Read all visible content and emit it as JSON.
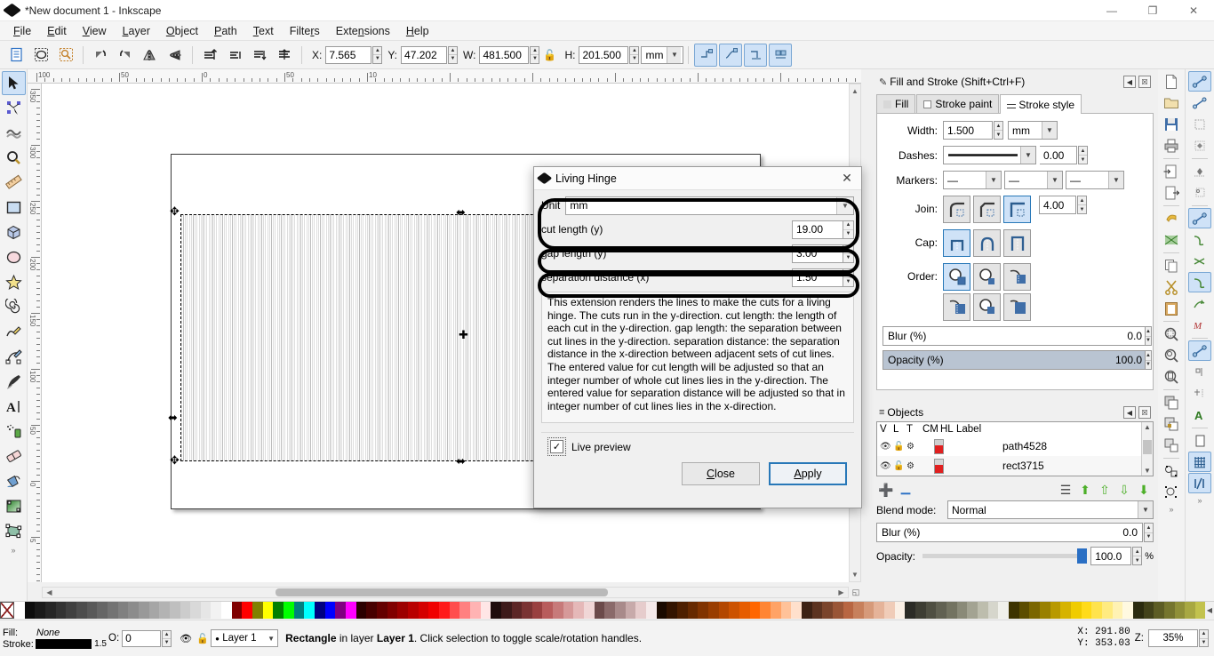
{
  "window": {
    "title": "*New document 1 - Inkscape",
    "app_icon": "inkscape-logo-icon",
    "controls": {
      "minimize": "—",
      "maximize": "❐",
      "close": "✕"
    }
  },
  "menubar": {
    "items": [
      {
        "label": "File",
        "accel": "F"
      },
      {
        "label": "Edit",
        "accel": "E"
      },
      {
        "label": "View",
        "accel": "V"
      },
      {
        "label": "Layer",
        "accel": "L"
      },
      {
        "label": "Object",
        "accel": "O"
      },
      {
        "label": "Path",
        "accel": "P"
      },
      {
        "label": "Text",
        "accel": "T"
      },
      {
        "label": "Filters",
        "accel": "F"
      },
      {
        "label": "Extensions",
        "accel": "n"
      },
      {
        "label": "Help",
        "accel": "H"
      }
    ]
  },
  "commandbar": {
    "buttons": [
      {
        "name": "select-all-icon",
        "glyph": "☰"
      },
      {
        "name": "select-all-in-all-layers-icon",
        "glyph": "⬚"
      },
      {
        "name": "deselect-icon",
        "glyph": "▢"
      },
      {
        "name": "rotate-90-ccw-icon",
        "glyph": "↺"
      },
      {
        "name": "rotate-90-cw-icon",
        "glyph": "↻"
      },
      {
        "name": "flip-horizontal-icon",
        "glyph": "◀▶"
      },
      {
        "name": "flip-vertical-icon",
        "glyph": "◁"
      },
      {
        "name": "raise-to-top-icon",
        "glyph": "⤒"
      },
      {
        "name": "raise-icon",
        "glyph": "↑"
      },
      {
        "name": "lower-icon",
        "glyph": "↓"
      },
      {
        "name": "lower-to-bottom-icon",
        "glyph": "⤓"
      }
    ],
    "snap_buttons": [
      {
        "name": "snap-nodes-icon",
        "glyph": "↱"
      },
      {
        "name": "snap-paths-icon",
        "glyph": "↰"
      },
      {
        "name": "snap-bbox-icon",
        "glyph": "↳"
      },
      {
        "name": "snap-page-icon",
        "glyph": "⇉"
      }
    ]
  },
  "transform": {
    "x": {
      "label": "X:",
      "value": "7.565"
    },
    "y": {
      "label": "Y:",
      "value": "47.202"
    },
    "w": {
      "label": "W:",
      "value": "481.500"
    },
    "lock_icon": "lock-ratio-icon",
    "h": {
      "label": "H:",
      "value": "201.500"
    },
    "unit": "mm"
  },
  "toolbox": {
    "tools": [
      {
        "name": "selector-tool",
        "glyph": "➤",
        "selected": true
      },
      {
        "name": "node-tool",
        "glyph": "✶",
        "selected": false
      },
      {
        "name": "tweak-tool",
        "glyph": "≋",
        "selected": false
      },
      {
        "name": "zoom-tool",
        "glyph": "⌕",
        "selected": false
      },
      {
        "name": "measure-tool",
        "glyph": "⌗",
        "selected": false
      },
      {
        "name": "rectangle-tool",
        "glyph": "▭",
        "selected": false
      },
      {
        "name": "3dbox-tool",
        "glyph": "⬡",
        "selected": false
      },
      {
        "name": "ellipse-tool",
        "glyph": "◯",
        "selected": false
      },
      {
        "name": "star-tool",
        "glyph": "★",
        "selected": false
      },
      {
        "name": "spiral-tool",
        "glyph": "◎",
        "selected": false
      },
      {
        "name": "pencil-tool",
        "glyph": "✎",
        "selected": false
      },
      {
        "name": "bezier-tool",
        "glyph": "✐",
        "selected": false
      },
      {
        "name": "calligraphy-tool",
        "glyph": "✒",
        "selected": false
      },
      {
        "name": "text-tool",
        "glyph": "A",
        "selected": false
      },
      {
        "name": "spray-tool",
        "glyph": "⁂",
        "selected": false
      },
      {
        "name": "eraser-tool",
        "glyph": "▱",
        "selected": false
      },
      {
        "name": "paint-bucket-tool",
        "glyph": "◢",
        "selected": false
      },
      {
        "name": "gradient-tool",
        "glyph": "▨",
        "selected": false
      },
      {
        "name": "connector-tool",
        "glyph": "⬚",
        "selected": false
      }
    ],
    "overflow": "»"
  },
  "rulers": {
    "horizontal_labels": [
      "100",
      "50",
      "0",
      "50",
      "10"
    ],
    "vertical_labels": [
      "350",
      "300",
      "250",
      "200",
      "150",
      "100",
      "50",
      "0",
      "5"
    ],
    "lock_icon": "ruler-lock-icon"
  },
  "canvas": {
    "selection_handles": "scale-arrows",
    "cursor": "crosshair-cursor",
    "object": "living-hinge-rect"
  },
  "dialog": {
    "title": "Living Hinge",
    "icon": "inkscape-logo-icon",
    "close_icon": "close-icon",
    "fields": [
      {
        "label": "Unit",
        "type": "select",
        "value": "mm",
        "name": "unit-select"
      },
      {
        "label": "cut length (y)",
        "type": "number",
        "value": "19.00",
        "name": "cut-length-input"
      },
      {
        "label": "gap length (y)",
        "type": "number",
        "value": "3.00",
        "name": "gap-length-input"
      },
      {
        "label": "separation distance (x)",
        "type": "number",
        "value": "1.50",
        "name": "separation-distance-input"
      }
    ],
    "description": "This extension renders the lines to make the cuts for a living hinge. The cuts run in the y-direction. cut length: the length of each cut in the y-direction. gap length: the separation between cut lines in the y-direction. separation distance: the separation distance in the x-direction between adjacent sets of cut lines. The entered value for cut length will be adjusted so that an integer number of whole cut lines lies in the y-direction. The entered value for separation distance will be adjusted so that in integer number of cut lines lies in the x-direction.",
    "live_preview": {
      "label": "Live preview",
      "checked": true,
      "check_glyph": "✓"
    },
    "buttons": {
      "close": "Close",
      "apply": "Apply"
    }
  },
  "fill_stroke": {
    "panel_title": "Fill and Stroke (Shift+Ctrl+F)",
    "panel_icon": "fill-stroke-icon",
    "dock_buttons": {
      "collapse": "◀",
      "close": "☒"
    },
    "tabs": [
      {
        "label": "Fill",
        "name": "tab-fill",
        "active": false
      },
      {
        "label": "Stroke paint",
        "name": "tab-stroke-paint",
        "active": false
      },
      {
        "label": "Stroke style",
        "name": "tab-stroke-style",
        "active": true
      }
    ],
    "width": {
      "label": "Width:",
      "value": "1.500",
      "unit": "mm"
    },
    "dashes": {
      "label": "Dashes:",
      "pattern": "solid-line",
      "offset": "0.00"
    },
    "markers": {
      "label": "Markers:",
      "start": "—",
      "mid": "—",
      "end": "—"
    },
    "join": {
      "label": "Join:",
      "options": [
        "round-join",
        "bevel-join",
        "miter-join"
      ],
      "selected": 2,
      "miter_limit": "4.00"
    },
    "cap": {
      "label": "Cap:",
      "options": [
        "butt-cap",
        "round-cap",
        "square-cap"
      ],
      "selected": 0
    },
    "order": {
      "label": "Order:",
      "options": [
        "fill-stroke-markers",
        "fill-markers-stroke",
        "stroke-fill-markers",
        "stroke-markers-fill",
        "markers-fill-stroke",
        "markers-stroke-fill"
      ],
      "selected": 0
    },
    "blur": {
      "label": "Blur (%)",
      "value": "0.0"
    },
    "opacity": {
      "label": "Opacity (%)",
      "value": "100.0",
      "percent": 100
    }
  },
  "objects": {
    "panel_title": "Objects",
    "panel_icon": "objects-icon",
    "dock_buttons": {
      "collapse": "◀",
      "close": "☒"
    },
    "columns": [
      "V",
      "L",
      "T",
      "CM",
      "HL",
      "Label"
    ],
    "rows": [
      {
        "label": "path4528",
        "visible_icon": "eye-icon",
        "lock_icon": "unlock-icon",
        "type_icon": "object-icon",
        "swatch_top": "#cfcfcf",
        "swatch_bottom": "#e02020"
      },
      {
        "label": "rect3715",
        "visible_icon": "eye-icon",
        "lock_icon": "unlock-icon",
        "type_icon": "object-icon",
        "swatch_top": "#d6d6d6",
        "swatch_bottom": "#e02020"
      }
    ],
    "tools": [
      {
        "name": "add-layer-button",
        "glyph": "＋",
        "color": "#2a6fc4"
      },
      {
        "name": "remove-layer-button",
        "glyph": "−",
        "color": "#2a6fc4"
      },
      {
        "name": "layer-options-button",
        "glyph": "≡",
        "color": "#444"
      },
      {
        "name": "raise-to-top-button",
        "glyph": "⇧",
        "color": "#4caf28"
      },
      {
        "name": "raise-button",
        "glyph": "↑",
        "color": "#4caf28"
      },
      {
        "name": "lower-button",
        "glyph": "↓",
        "color": "#4caf28"
      },
      {
        "name": "lower-to-bottom-button",
        "glyph": "⇩",
        "color": "#4caf28"
      }
    ],
    "blend_mode": {
      "label": "Blend mode:",
      "value": "Normal"
    },
    "blur": {
      "label": "Blur (%)",
      "value": "0.0"
    },
    "opacity": {
      "label": "Opacity:",
      "value": "100.0",
      "unit": "%",
      "percent": 100
    }
  },
  "snapbar": {
    "buttons": [
      {
        "name": "enable-snapping-icon",
        "glyph": "⚯",
        "on": true
      },
      {
        "name": "snap-bounding-boxes-icon",
        "glyph": "⚯",
        "on": false
      },
      {
        "name": "snap-bbox-edges-icon",
        "glyph": "⬚",
        "on": false
      },
      {
        "name": "snap-bbox-corners-icon",
        "glyph": "◇",
        "on": false
      },
      {
        "name": "snap-bbox-edge-midpoints-icon",
        "glyph": "◆",
        "on": false
      },
      {
        "name": "snap-bbox-centers-icon",
        "glyph": "○",
        "on": false
      },
      {
        "name": "snap-nodes-paths-icon",
        "glyph": "⚯",
        "on": true
      },
      {
        "name": "snap-paths-icon",
        "glyph": "∿",
        "on": false
      },
      {
        "name": "snap-path-intersections-icon",
        "glyph": "✕",
        "on": false
      },
      {
        "name": "snap-cusp-nodes-icon",
        "glyph": "∿",
        "on": true
      },
      {
        "name": "snap-smooth-nodes-icon",
        "glyph": "⤳",
        "on": false
      },
      {
        "name": "snap-midpoints-icon",
        "glyph": "⋈",
        "on": false
      },
      {
        "name": "snap-others-icon",
        "glyph": "⚯",
        "on": true
      },
      {
        "name": "snap-object-centers-icon",
        "glyph": "▫",
        "on": false
      },
      {
        "name": "snap-rotation-centers-icon",
        "glyph": "⊕",
        "on": false
      },
      {
        "name": "snap-text-baseline-icon",
        "glyph": "A",
        "on": false
      },
      {
        "name": "snap-page-border-icon",
        "glyph": "▭",
        "on": false
      },
      {
        "name": "snap-grids-icon",
        "glyph": "▦",
        "on": true
      },
      {
        "name": "snap-guides-icon",
        "glyph": "⫽",
        "on": true
      }
    ],
    "overflow": "»"
  },
  "filebar": {
    "buttons": [
      {
        "name": "new-document-icon",
        "glyph": "☐"
      },
      {
        "name": "open-document-icon",
        "glyph": "Ὄ1"
      },
      {
        "name": "save-document-icon",
        "glyph": "▣"
      },
      {
        "name": "print-document-icon",
        "glyph": "⎙"
      },
      {
        "name": "import-icon",
        "glyph": "⬒"
      },
      {
        "name": "export-icon",
        "glyph": "⬓"
      },
      {
        "name": "undo-icon",
        "glyph": "↶"
      },
      {
        "name": "redo-icon",
        "glyph": "↷"
      },
      {
        "name": "copy-icon",
        "glyph": "⧉"
      },
      {
        "name": "cut-icon",
        "glyph": "✀"
      },
      {
        "name": "paste-icon",
        "glyph": "Ὄb"
      },
      {
        "name": "zoom-selection-icon",
        "glyph": "⌕"
      },
      {
        "name": "zoom-drawing-icon",
        "glyph": "⌕"
      },
      {
        "name": "zoom-page-icon",
        "glyph": "⌕"
      },
      {
        "name": "duplicate-icon",
        "glyph": "⧉"
      },
      {
        "name": "group-icon",
        "glyph": "◱"
      },
      {
        "name": "ungroup-icon",
        "glyph": "◲"
      },
      {
        "name": "xml-editor-icon",
        "glyph": "⚙"
      },
      {
        "name": "preferences-icon",
        "glyph": "☸"
      }
    ],
    "overflow": "»"
  },
  "statusbar": {
    "fill": {
      "label": "Fill:",
      "value": "None"
    },
    "stroke": {
      "label": "Stroke:",
      "swatch": "#000000",
      "width": "1.5"
    },
    "opacity": {
      "label": "O:",
      "value": "0"
    },
    "layer_visibility_icon": "eye-icon",
    "layer_lock_icon": "unlock-icon",
    "layer": "Layer 1",
    "message_object": "Rectangle",
    "message_prefix": " in layer ",
    "message_layer": "Layer 1",
    "message_suffix": ". Click selection to toggle scale/rotation handles.",
    "coords": {
      "x_label": "X:",
      "x": "291.80",
      "y_label": "Y:",
      "y": "353.03"
    },
    "zoom": {
      "label": "Z:",
      "value": "35%"
    }
  },
  "palette": {
    "none_swatch": "X",
    "colors": [
      "#ffffff",
      "#0d0d0d",
      "#1a1a1a",
      "#262626",
      "#333333",
      "#404040",
      "#4d4d4d",
      "#595959",
      "#666666",
      "#737373",
      "#808080",
      "#8c8c8c",
      "#999999",
      "#a6a6a6",
      "#b3b3b3",
      "#bfbfbf",
      "#cccccc",
      "#d9d9d9",
      "#e6e6e6",
      "#f2f2f2",
      "#ffffff",
      "#800000",
      "#ff0000",
      "#808000",
      "#ffff00",
      "#008000",
      "#00ff00",
      "#008080",
      "#00ffff",
      "#000080",
      "#0000ff",
      "#800080",
      "#ff00ff",
      "#2b0000",
      "#470000",
      "#640000",
      "#800000",
      "#9c0000",
      "#b80000",
      "#d40000",
      "#f00000",
      "#ff1a1a",
      "#ff4d4d",
      "#ff8080",
      "#ffb3b3",
      "#ffe6e6",
      "#1f0d0d",
      "#3d1a1a",
      "#5c2626",
      "#7a3333",
      "#994040",
      "#b85c5c",
      "#c77a7a",
      "#d69999",
      "#e5b8b8",
      "#f0d6d6",
      "#6b4a4a",
      "#8a6a6a",
      "#a88a8a",
      "#c7aaaa",
      "#e6cccc",
      "#f5eaea",
      "#1a0a00",
      "#331400",
      "#4d1f00",
      "#662900",
      "#803300",
      "#993d00",
      "#b34700",
      "#cc5200",
      "#e65c00",
      "#ff6600",
      "#ff8533",
      "#ffa366",
      "#ffc299",
      "#ffe0cc",
      "#3d2214",
      "#5c3320",
      "#7a442b",
      "#995536",
      "#b86642",
      "#c7805c",
      "#d69a7a",
      "#e5b399",
      "#f0ccb8",
      "#faf0e6",
      "#2b2b26",
      "#3d3d33",
      "#4f4f42",
      "#616152",
      "#737361",
      "#8a8a78",
      "#a3a392",
      "#bdbdad",
      "#d6d6cc",
      "#f0f0eb",
      "#3d3300",
      "#5c4d00",
      "#7a6600",
      "#998000",
      "#b89900",
      "#d6b300",
      "#f0cc00",
      "#ffdb1a",
      "#ffe34d",
      "#ffeb80",
      "#fff2b3",
      "#fff9e0",
      "#2b2b0f",
      "#42421a",
      "#5c5c24",
      "#75752e",
      "#8f8f38",
      "#a8a842",
      "#c2c24d"
    ]
  }
}
